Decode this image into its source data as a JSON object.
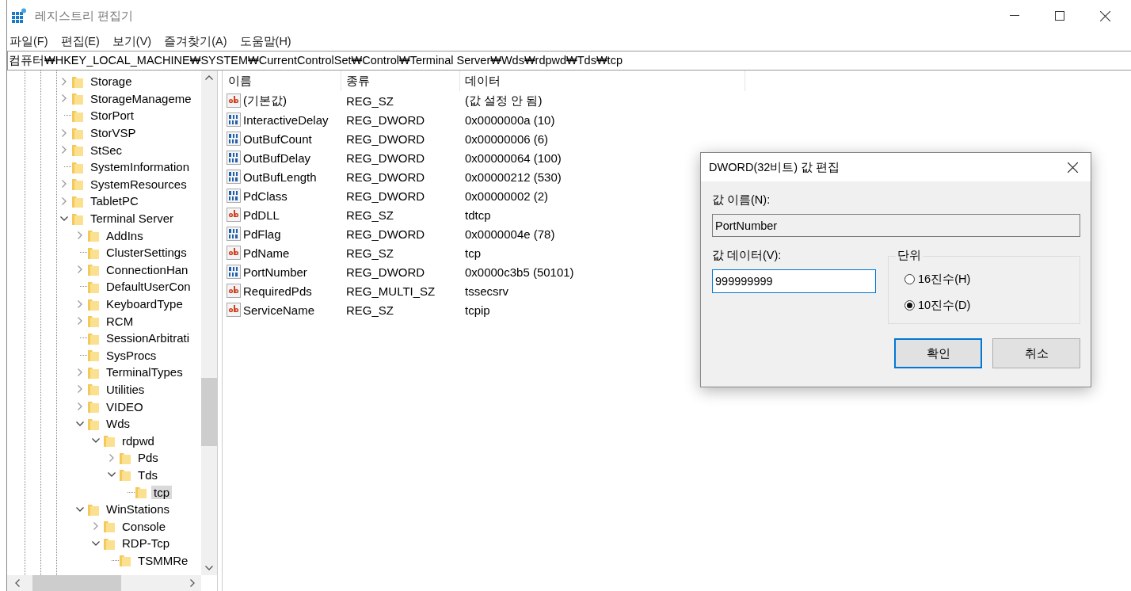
{
  "window": {
    "title": "레지스트리 편집기"
  },
  "menu": [
    "파일(F)",
    "편집(E)",
    "보기(V)",
    "즐겨찾기(A)",
    "도움말(H)"
  ],
  "address": "컴퓨터₩HKEY_LOCAL_MACHINE₩SYSTEM₩CurrentControlSet₩Control₩Terminal Server₩Wds₩rdpwd₩Tds₩tcp",
  "tree": [
    {
      "label": "Storage",
      "kind": "branch",
      "expanded": false,
      "selected": false
    },
    {
      "label": "StorageManageme",
      "kind": "branch",
      "expanded": false,
      "selected": false
    },
    {
      "label": "StorPort",
      "kind": "leaf",
      "selected": false
    },
    {
      "label": "StorVSP",
      "kind": "branch",
      "expanded": false,
      "selected": false
    },
    {
      "label": "StSec",
      "kind": "branch",
      "expanded": false,
      "selected": false
    },
    {
      "label": "SystemInformation",
      "kind": "leaf",
      "selected": false
    },
    {
      "label": "SystemResources",
      "kind": "branch",
      "expanded": false,
      "selected": false
    },
    {
      "label": "TabletPC",
      "kind": "branch",
      "expanded": false,
      "selected": false
    },
    {
      "label": "Terminal Server",
      "kind": "branch",
      "expanded": true,
      "selected": false,
      "children": [
        {
          "label": "AddIns",
          "kind": "branch",
          "expanded": false,
          "selected": false
        },
        {
          "label": "ClusterSettings",
          "kind": "leaf",
          "selected": false
        },
        {
          "label": "ConnectionHan",
          "kind": "branch",
          "expanded": false,
          "selected": false
        },
        {
          "label": "DefaultUserCon",
          "kind": "leaf",
          "selected": false
        },
        {
          "label": "KeyboardType",
          "kind": "branch",
          "expanded": false,
          "selected": false
        },
        {
          "label": "RCM",
          "kind": "branch",
          "expanded": false,
          "selected": false
        },
        {
          "label": "SessionArbitrati",
          "kind": "leaf",
          "selected": false
        },
        {
          "label": "SysProcs",
          "kind": "leaf",
          "selected": false
        },
        {
          "label": "TerminalTypes",
          "kind": "branch",
          "expanded": false,
          "selected": false
        },
        {
          "label": "Utilities",
          "kind": "branch",
          "expanded": false,
          "selected": false
        },
        {
          "label": "VIDEO",
          "kind": "branch",
          "expanded": false,
          "selected": false
        },
        {
          "label": "Wds",
          "kind": "branch",
          "expanded": true,
          "selected": false,
          "children": [
            {
              "label": "rdpwd",
              "kind": "branch",
              "expanded": true,
              "selected": false,
              "children": [
                {
                  "label": "Pds",
                  "kind": "branch",
                  "expanded": false,
                  "selected": false
                },
                {
                  "label": "Tds",
                  "kind": "branch",
                  "expanded": true,
                  "selected": false,
                  "children": [
                    {
                      "label": "tcp",
                      "kind": "leaf",
                      "selected": true
                    }
                  ]
                }
              ]
            }
          ]
        },
        {
          "label": "WinStations",
          "kind": "branch",
          "expanded": true,
          "selected": false,
          "children": [
            {
              "label": "Console",
              "kind": "branch",
              "expanded": false,
              "selected": false
            },
            {
              "label": "RDP-Tcp",
              "kind": "branch",
              "expanded": true,
              "selected": false,
              "children": [
                {
                  "label": "TSMMRe",
                  "kind": "leaf",
                  "selected": false
                }
              ]
            }
          ]
        }
      ]
    }
  ],
  "table": {
    "columns": [
      "이름",
      "종류",
      "데이터"
    ],
    "rows": [
      {
        "kind": "string",
        "name": "(기본값)",
        "type": "REG_SZ",
        "data": "(값 설정 안 됨)"
      },
      {
        "kind": "number",
        "name": "InteractiveDelay",
        "type": "REG_DWORD",
        "data": "0x0000000a (10)"
      },
      {
        "kind": "number",
        "name": "OutBufCount",
        "type": "REG_DWORD",
        "data": "0x00000006 (6)"
      },
      {
        "kind": "number",
        "name": "OutBufDelay",
        "type": "REG_DWORD",
        "data": "0x00000064 (100)"
      },
      {
        "kind": "number",
        "name": "OutBufLength",
        "type": "REG_DWORD",
        "data": "0x00000212 (530)"
      },
      {
        "kind": "number",
        "name": "PdClass",
        "type": "REG_DWORD",
        "data": "0x00000002 (2)"
      },
      {
        "kind": "string",
        "name": "PdDLL",
        "type": "REG_SZ",
        "data": "tdtcp"
      },
      {
        "kind": "number",
        "name": "PdFlag",
        "type": "REG_DWORD",
        "data": "0x0000004e (78)"
      },
      {
        "kind": "string",
        "name": "PdName",
        "type": "REG_SZ",
        "data": "tcp"
      },
      {
        "kind": "number",
        "name": "PortNumber",
        "type": "REG_DWORD",
        "data": "0x0000c3b5 (50101)"
      },
      {
        "kind": "string",
        "name": "RequiredPds",
        "type": "REG_MULTI_SZ",
        "data": "tssecsrv"
      },
      {
        "kind": "string",
        "name": "ServiceName",
        "type": "REG_SZ",
        "data": "tcpip"
      }
    ]
  },
  "dialog": {
    "title": "DWORD(32비트) 값 편집",
    "name_label": "값 이름(N):",
    "name_value": "PortNumber",
    "data_label": "값 데이터(V):",
    "data_value": "999999999",
    "base_group": "단위",
    "base_options": [
      {
        "label": "16진수(H)",
        "selected": false
      },
      {
        "label": "10진수(D)",
        "selected": true
      }
    ],
    "buttons": [
      {
        "label": "확인",
        "default": true
      },
      {
        "label": "취소",
        "default": false
      }
    ]
  }
}
